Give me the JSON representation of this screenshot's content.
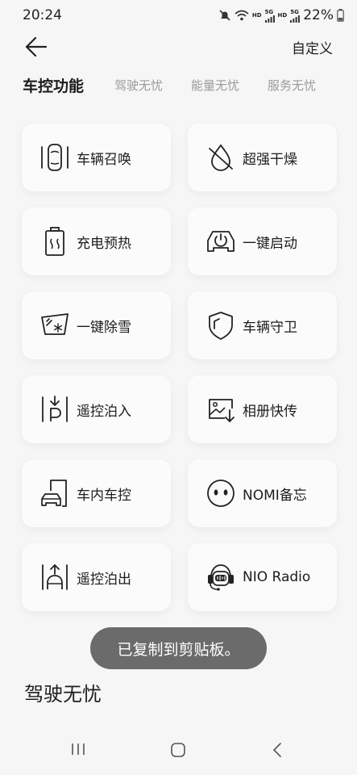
{
  "status": {
    "time": "20:24",
    "hd1": "HD",
    "sg1": "5G",
    "hd2": "HD",
    "sg2": "5G",
    "battery": "22%"
  },
  "header": {
    "custom_label": "自定义"
  },
  "tabs": [
    {
      "label": "车控功能",
      "active": true
    },
    {
      "label": "驾驶无忧",
      "active": false
    },
    {
      "label": "能量无忧",
      "active": false
    },
    {
      "label": "服务无忧",
      "active": false
    }
  ],
  "features": [
    {
      "label": "车辆召唤",
      "icon": "car-summon-icon"
    },
    {
      "label": "超强干燥",
      "icon": "water-drop-icon"
    },
    {
      "label": "充电预热",
      "icon": "battery-heat-icon"
    },
    {
      "label": "一键启动",
      "icon": "car-power-icon"
    },
    {
      "label": "一键除雪",
      "icon": "windshield-snow-icon"
    },
    {
      "label": "车辆守卫",
      "icon": "shield-icon"
    },
    {
      "label": "遥控泊入",
      "icon": "park-in-icon"
    },
    {
      "label": "相册快传",
      "icon": "photo-transfer-icon"
    },
    {
      "label": "车内车控",
      "icon": "phone-car-icon"
    },
    {
      "label": "NOMI备忘",
      "icon": "nomi-face-icon"
    },
    {
      "label": "遥控泊出",
      "icon": "park-out-icon"
    },
    {
      "label": "NIO Radio",
      "icon": "radio-robot-icon"
    }
  ],
  "toast": "已复制到剪贴板。",
  "section_title": "驾驶无忧"
}
